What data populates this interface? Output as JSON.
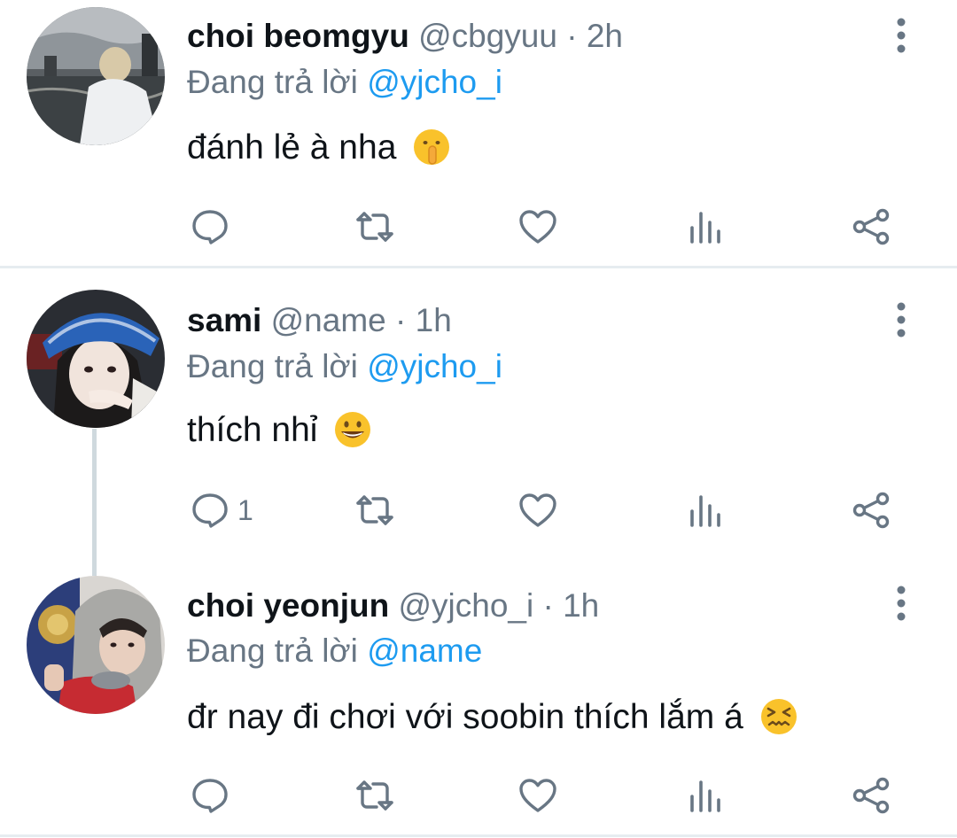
{
  "tweets": [
    {
      "name": "choi beomgyu",
      "handle": "@cbgyuu · 2h",
      "replying_prefix": "Đang trả lời ",
      "replying_to": "@yjcho_i",
      "text": "đánh lẻ à nha",
      "emoji": "shushing-face",
      "reply_count": ""
    },
    {
      "name": "sami",
      "handle": "@name · 1h",
      "replying_prefix": "Đang trả lời ",
      "replying_to": "@yjcho_i",
      "text": "thích nhỉ",
      "emoji": "grinning-face",
      "reply_count": "1"
    },
    {
      "name": "choi yeonjun",
      "handle": "@yjcho_i · 1h",
      "replying_prefix": "Đang trả lời ",
      "replying_to": "@name",
      "text": "đr nay đi chơi với soobin thích lắm á",
      "emoji": "confounded-face",
      "reply_count": ""
    }
  ],
  "actions": [
    "reply-icon",
    "retweet-icon",
    "like-icon",
    "analytics-icon",
    "share-icon"
  ],
  "colors": {
    "link": "#1d9bf0",
    "secondary": "#687684",
    "text": "#0f1419",
    "divider": "#e6ecf0",
    "thread": "#cfd9de"
  }
}
